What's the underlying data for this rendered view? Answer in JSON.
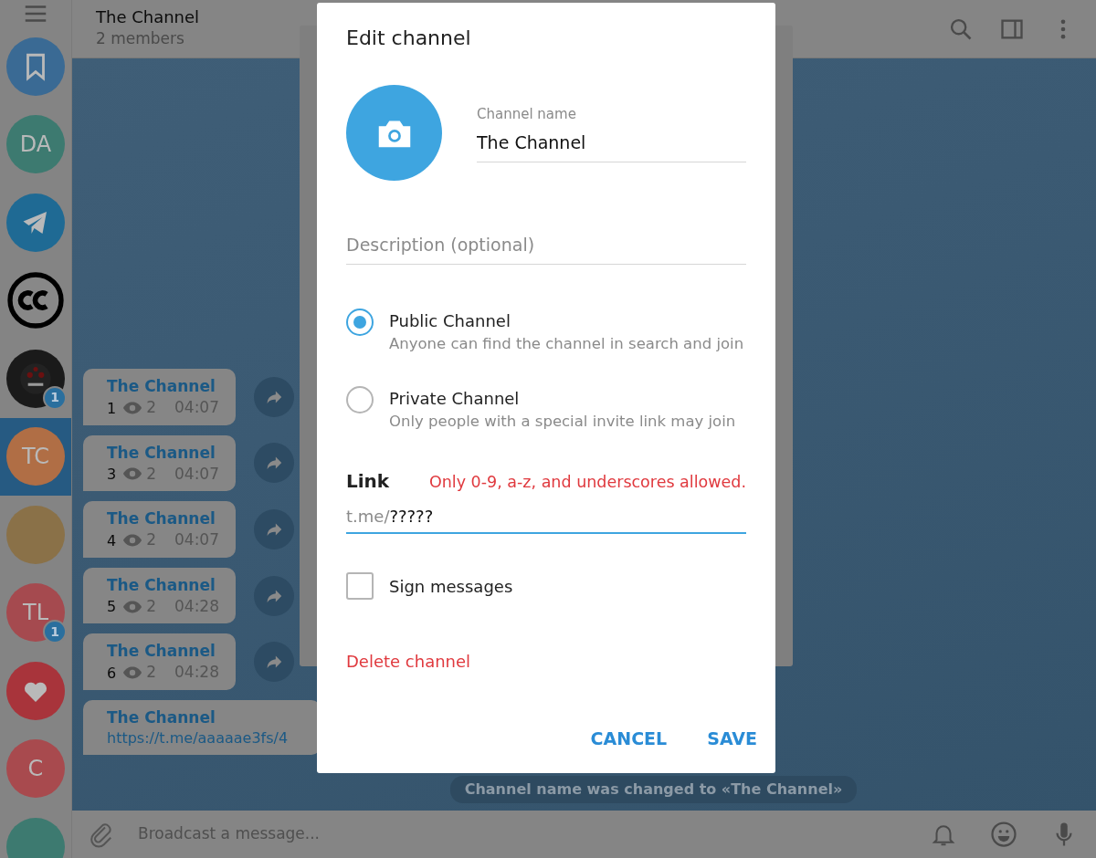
{
  "header": {
    "title": "The Channel",
    "subtitle": "2 members"
  },
  "chats": [
    {
      "kind": "saved",
      "color": "#3a6a94",
      "selected": false
    },
    {
      "kind": "initials",
      "initials": "DA",
      "color": "#3d7a70",
      "selected": false
    },
    {
      "kind": "telegram",
      "color": "#1f6a94",
      "selected": false
    },
    {
      "kind": "cc",
      "selected": false
    },
    {
      "kind": "image",
      "badge": "1",
      "selected": false
    },
    {
      "kind": "initials",
      "initials": "TC",
      "color": "#b06e45",
      "selected": true
    },
    {
      "kind": "photo",
      "selected": false
    },
    {
      "kind": "initials",
      "initials": "TL",
      "color": "#a54a4f",
      "badge": "1",
      "selected": false
    },
    {
      "kind": "heart",
      "color": "#a8343b",
      "selected": false
    },
    {
      "kind": "initials",
      "initials": "C",
      "color": "#a84a4e",
      "selected": false
    },
    {
      "kind": "initials",
      "color": "#3d7a70",
      "selected": false
    }
  ],
  "messages": [
    {
      "kind": "post",
      "sender": "The Channel",
      "text": "1",
      "views": "2",
      "time": "04:07"
    },
    {
      "kind": "post",
      "sender": "The Channel",
      "text": "3",
      "views": "2",
      "time": "04:07"
    },
    {
      "kind": "post",
      "sender": "The Channel",
      "text": "4",
      "views": "2",
      "time": "04:07"
    },
    {
      "kind": "post",
      "sender": "The Channel",
      "text": "5",
      "views": "2",
      "time": "04:28"
    },
    {
      "kind": "post",
      "sender": "The Channel",
      "text": "6",
      "views": "2",
      "time": "04:28"
    },
    {
      "kind": "link",
      "sender": "The Channel",
      "text": "https://t.me/aaaaae3fs/4"
    }
  ],
  "service_message": "Channel name was changed to «The Channel»",
  "composer": {
    "placeholder": "Broadcast a message..."
  },
  "dialog": {
    "title": "Edit channel",
    "name_field": {
      "label": "Channel name",
      "value": "The Channel"
    },
    "description_field": {
      "placeholder": "Description (optional)"
    },
    "options": [
      {
        "title": "Public Channel",
        "description": "Anyone can find the channel in search and join",
        "selected": true
      },
      {
        "title": "Private Channel",
        "description": "Only people with a special invite link may join",
        "selected": false
      }
    ],
    "link": {
      "label": "Link",
      "error": "Only 0-9, a-z, and underscores allowed.",
      "prefix": "t.me/",
      "value": "?????"
    },
    "sign_messages": {
      "label": "Sign messages",
      "checked": false
    },
    "delete_label": "Delete channel",
    "buttons": [
      {
        "label": "CANCEL"
      },
      {
        "label": "SAVE"
      }
    ]
  }
}
